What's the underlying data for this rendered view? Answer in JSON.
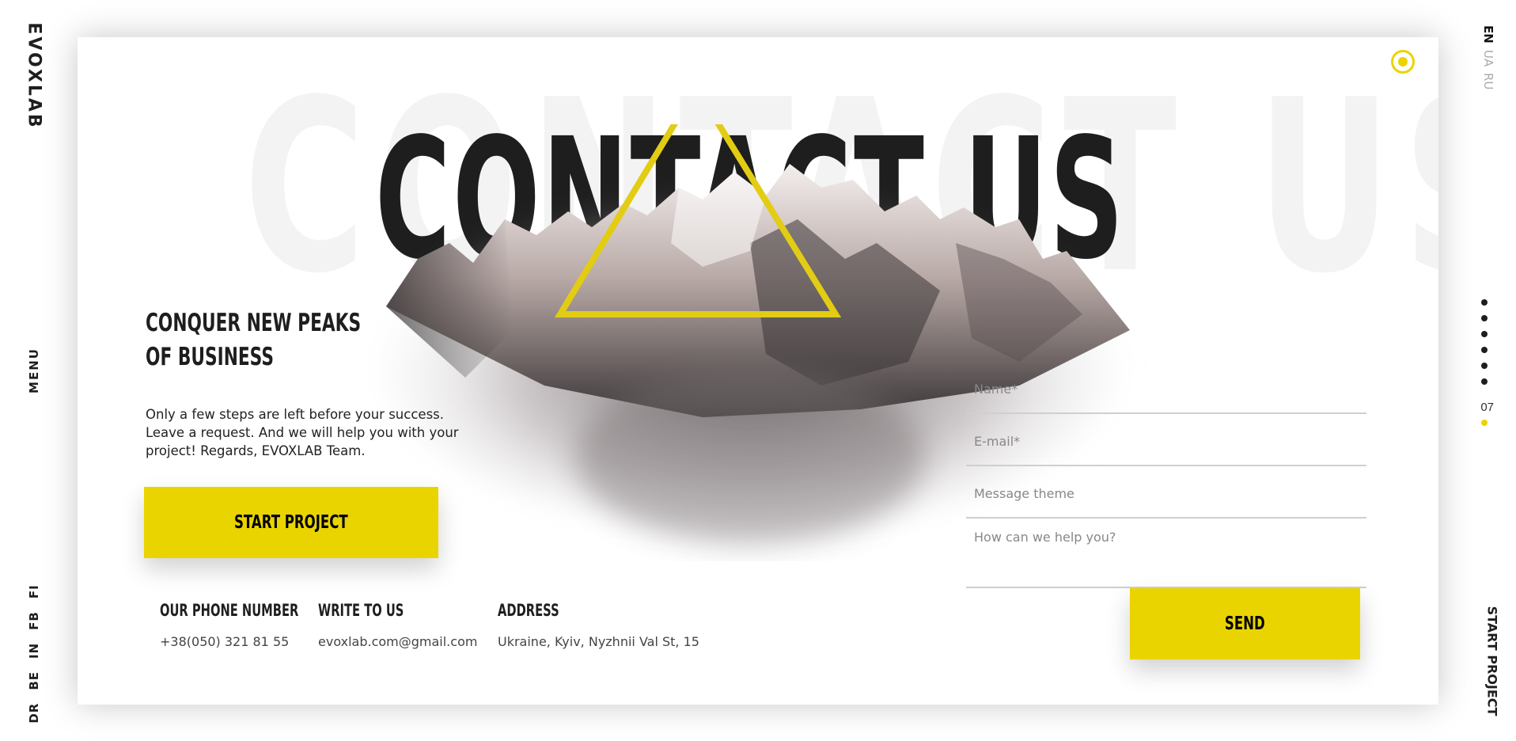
{
  "brand": {
    "logo": "EVOXLAB"
  },
  "nav": {
    "menu_label": "MENU"
  },
  "socials": [
    "DR",
    "BE",
    "IN",
    "FB",
    "FI"
  ],
  "languages": [
    {
      "code": "EN",
      "active": true
    },
    {
      "code": "UA",
      "active": false
    },
    {
      "code": "RU",
      "active": false
    }
  ],
  "pager": {
    "current_page": "07",
    "dot_count": 6
  },
  "side": {
    "start_project_label": "START PROJECT"
  },
  "hero": {
    "background_word": "CONTACT US",
    "title": "CONTACT US",
    "tagline_line1": "CONQUER NEW PEAKS",
    "tagline_line2": "OF BUSINESS",
    "description": "Only a few steps are left before your success. Leave a request. And we will help you with your project! Regards, EVOXLAB Team.",
    "cta_label": "START PROJECT"
  },
  "contacts": {
    "phone": {
      "label": "OUR PHONE NUMBER",
      "value": "+38(050) 321 81 55"
    },
    "email": {
      "label": "WRITE TO US",
      "value": "evoxlab.com@gmail.com"
    },
    "address": {
      "label": "ADDRESS",
      "value": "Ukraine, Kyiv, Nyzhnii Val St, 15"
    }
  },
  "form": {
    "name_placeholder": "Name*",
    "email_placeholder": "E-mail*",
    "theme_placeholder": "Message theme",
    "message_placeholder": "How can we help you?",
    "send_label": "SEND"
  },
  "colors": {
    "accent": "#ead400",
    "text": "#1e1e1e"
  }
}
